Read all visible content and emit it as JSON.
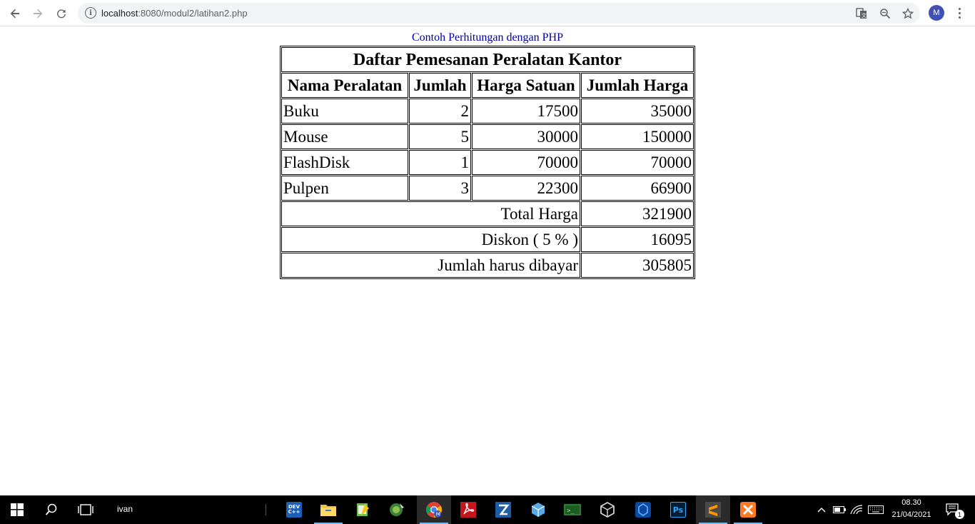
{
  "browser": {
    "url_host": "localhost",
    "url_path": ":8080/modul2/latihan2.php",
    "avatar_letter": "M",
    "icons": [
      "back-arrow-icon",
      "forward-arrow-icon",
      "reload-icon",
      "info-icon",
      "translate-icon",
      "zoom-icon",
      "bookmark-star-icon",
      "menu-dots-icon"
    ]
  },
  "page": {
    "caption": "Contoh Perhitungan dengan PHP",
    "table_title": "Daftar Pemesanan Peralatan Kantor",
    "headers": [
      "Nama Peralatan",
      "Jumlah",
      "Harga Satuan",
      "Jumlah Harga"
    ],
    "rows": [
      [
        "Buku",
        "2",
        "17500",
        "35000"
      ],
      [
        "Mouse",
        "5",
        "30000",
        "150000"
      ],
      [
        "FlashDisk",
        "1",
        "70000",
        "70000"
      ],
      [
        "Pulpen",
        "3",
        "22300",
        "66900"
      ]
    ],
    "summary": [
      {
        "label": "Total Harga",
        "value": "321900"
      },
      {
        "label": "Diskon ( 5 % )",
        "value": "16095"
      },
      {
        "label": "Jumlah harus dibayar",
        "value": "305805"
      }
    ]
  },
  "taskbar": {
    "search_text": "ivan",
    "time": "08.30",
    "date": "21/04/2021",
    "notification_count": "1",
    "apps": [
      {
        "name": "devcpp",
        "label": "DEV C++",
        "color": "#1c5fb4"
      },
      {
        "name": "file-explorer",
        "label": "",
        "color": "#f0c043"
      },
      {
        "name": "notepad-plus",
        "label": "",
        "color": "#6cc04a"
      },
      {
        "name": "app-green",
        "label": "",
        "color": "#3d7d3a"
      },
      {
        "name": "chrome",
        "label": "",
        "color": "#db4437"
      },
      {
        "name": "acrobat",
        "label": "",
        "color": "#c4161c"
      },
      {
        "name": "filezilla",
        "label": "",
        "color": "#bf0000"
      },
      {
        "name": "virtualbox-cube",
        "label": "",
        "color": "#5aa9e6"
      },
      {
        "name": "terminal",
        "label": "",
        "color": "#2e7d32"
      },
      {
        "name": "virtualbox",
        "label": "",
        "color": "#1f6fb2"
      },
      {
        "name": "app-blue",
        "label": "",
        "color": "#0d47a1"
      },
      {
        "name": "photoshop",
        "label": "Ps",
        "color": "#001e36"
      },
      {
        "name": "sublime-text",
        "label": "",
        "color": "#ff9800"
      },
      {
        "name": "xampp",
        "label": "",
        "color": "#fb7a24"
      }
    ]
  }
}
